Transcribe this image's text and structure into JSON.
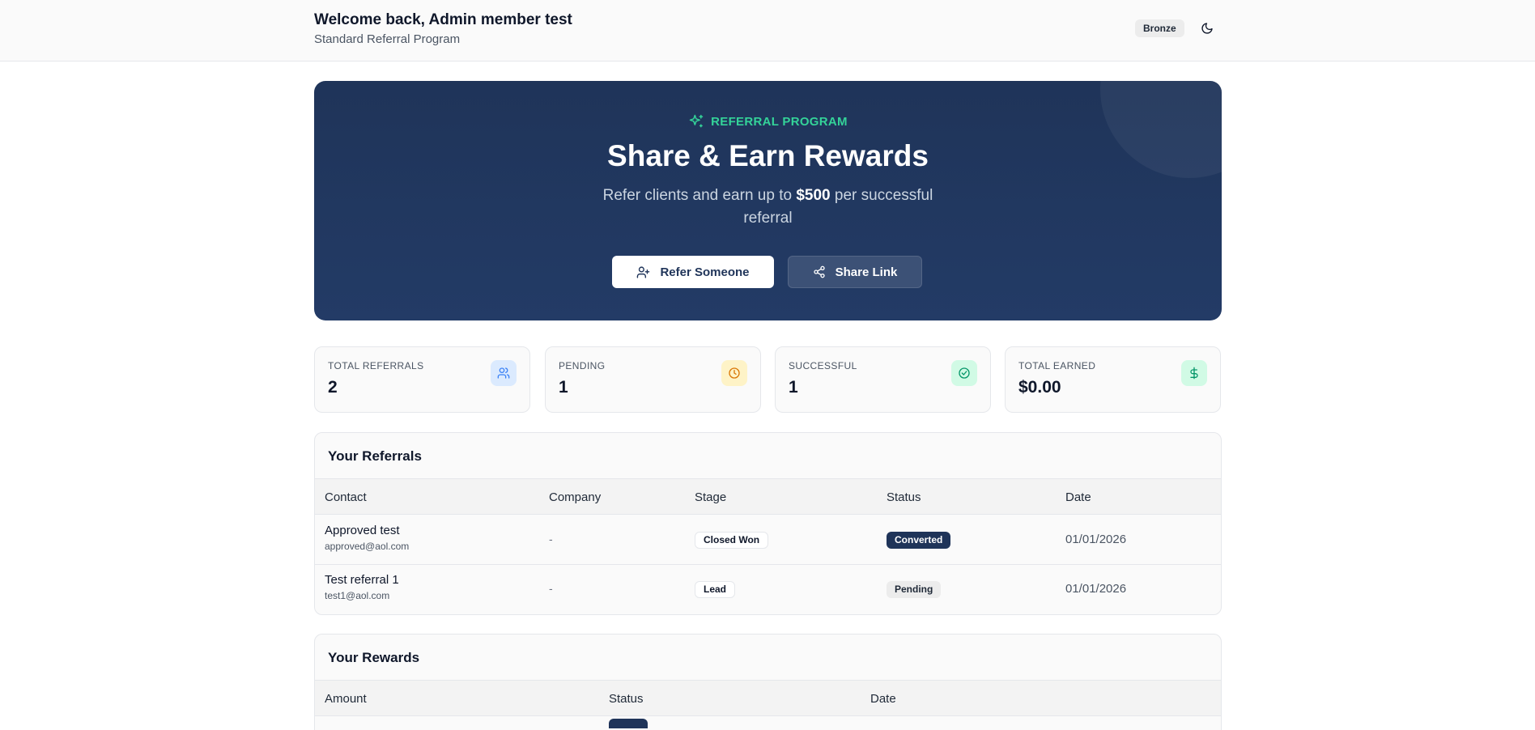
{
  "header": {
    "title": "Welcome back, Admin member test",
    "subtitle": "Standard Referral Program",
    "tier": "Bronze",
    "theme_toggle_icon": "moon-icon"
  },
  "hero": {
    "eyebrow": "REFERRAL PROGRAM",
    "headline": "Share & Earn Rewards",
    "lead_before": "Refer clients and earn up to ",
    "lead_amount": "$500",
    "lead_after": " per successful referral",
    "refer_button": "Refer Someone",
    "share_button": "Share Link",
    "accent_color": "#34d399",
    "background_color": "#1f3459"
  },
  "stats": [
    {
      "label": "TOTAL REFERRALS",
      "value": "2",
      "icon": "users-icon",
      "icon_color": "#3b82f6",
      "icon_bg": "#dbeafe"
    },
    {
      "label": "PENDING",
      "value": "1",
      "icon": "clock-icon",
      "icon_color": "#d97706",
      "icon_bg": "#fef3c7"
    },
    {
      "label": "SUCCESSFUL",
      "value": "1",
      "icon": "check-circle-icon",
      "icon_color": "#059669",
      "icon_bg": "#d1fae5"
    },
    {
      "label": "TOTAL EARNED",
      "value": "$0.00",
      "icon": "dollar-icon",
      "icon_color": "#059669",
      "icon_bg": "#d1fae5"
    }
  ],
  "referrals": {
    "title": "Your Referrals",
    "columns": [
      "Contact",
      "Company",
      "Stage",
      "Status",
      "Date"
    ],
    "rows": [
      {
        "name": "Approved test",
        "email": "approved@aol.com",
        "company": "-",
        "stage": "Closed Won",
        "status": "Converted",
        "date": "01/01/2026"
      },
      {
        "name": "Test referral 1",
        "email": "test1@aol.com",
        "company": "-",
        "stage": "Lead",
        "status": "Pending",
        "date": "01/01/2026"
      }
    ]
  },
  "rewards": {
    "title": "Your Rewards",
    "columns": [
      "Amount",
      "Status",
      "Date"
    ]
  }
}
